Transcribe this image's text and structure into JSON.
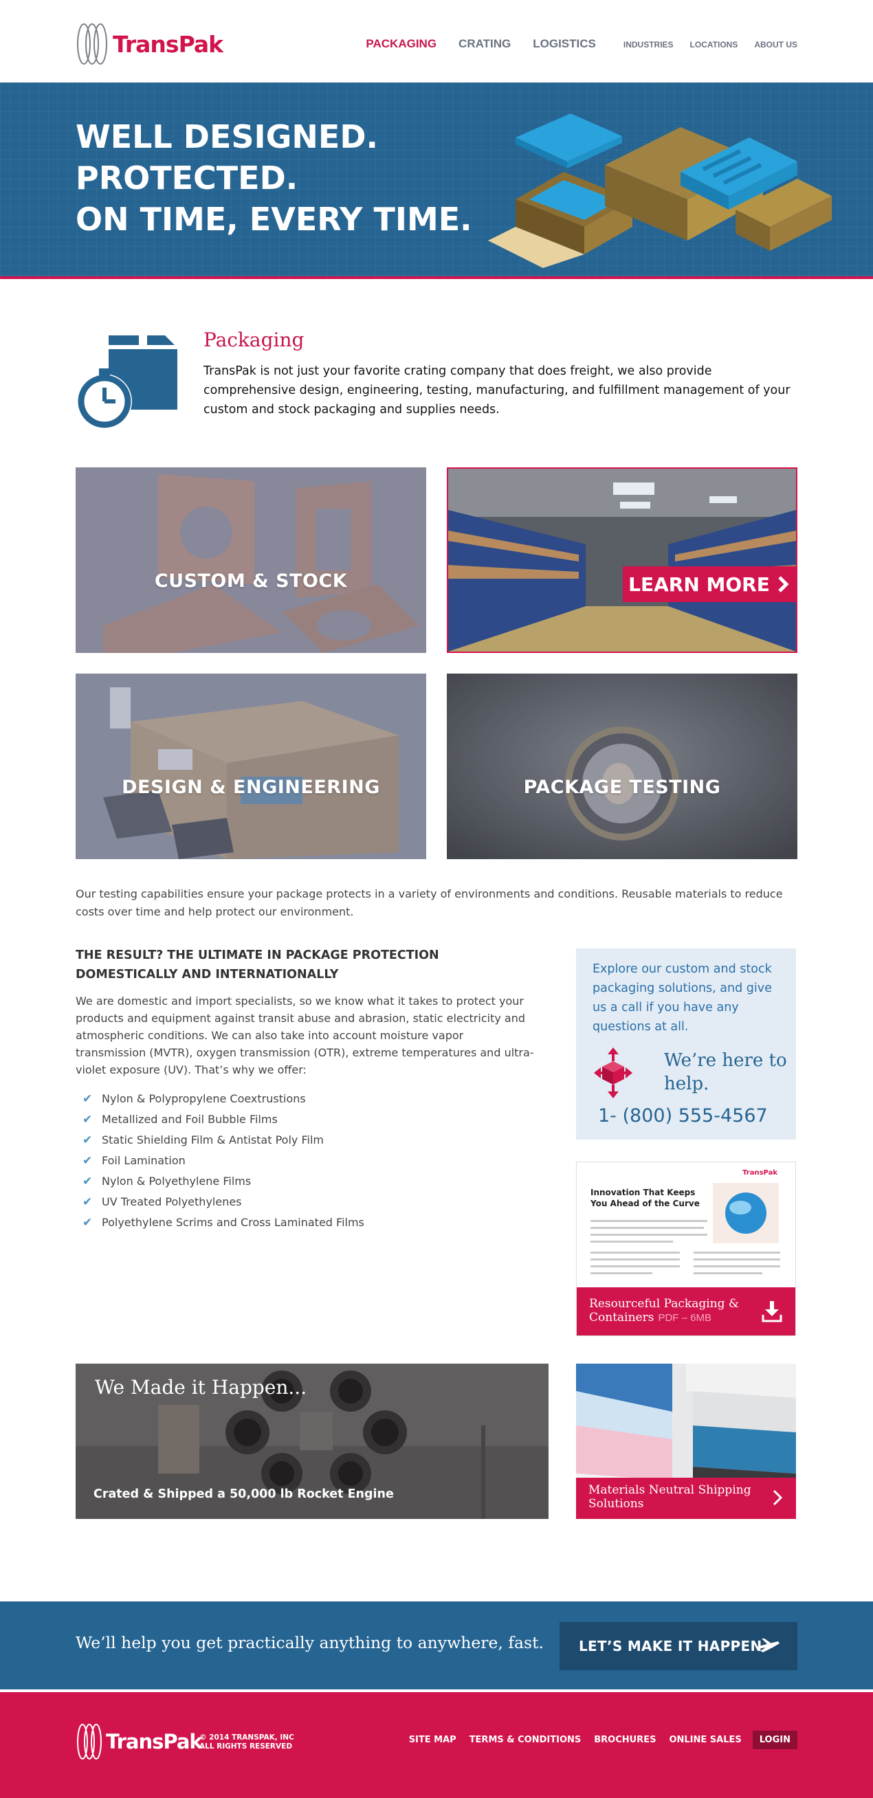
{
  "brand": {
    "name": "TransPak",
    "accent": "#d2144d",
    "blue": "#266492"
  },
  "nav": {
    "items": [
      {
        "label": "PACKAGING",
        "active": true
      },
      {
        "label": "CRATING",
        "active": false
      },
      {
        "label": "LOGISTICS",
        "active": false
      },
      {
        "label": "INDUSTRIES",
        "active": false
      },
      {
        "label": "LOCATIONS",
        "active": false
      },
      {
        "label": "ABOUT US",
        "active": false
      }
    ]
  },
  "hero": {
    "lines": [
      "WELL DESIGNED.",
      "PROTECTED.",
      "ON TIME, EVERY TIME."
    ]
  },
  "intro": {
    "icon": "box-stopwatch-icon",
    "title": "Packaging",
    "text": "TransPak is not just your favorite crating company that does freight, we also provide comprehensive design, engineering, testing, manufacturing, and fulfillment management of your custom and stock packaging and supplies needs."
  },
  "tiles": [
    {
      "label": "CUSTOM & STOCK"
    },
    {
      "label": "LEARN MORE",
      "button_icon": "chevron-right-icon"
    },
    {
      "label": "DESIGN & ENGINEERING"
    },
    {
      "label": "PACKAGE TESTING"
    }
  ],
  "testing_text": "Our testing capabilities ensure your package protects in a variety of environments and conditions. Reusable materials to reduce costs over time and help protect our environment.",
  "result": {
    "title": "THE RESULT? THE ULTIMATE IN PACKAGE PROTECTION DOMESTICALLY AND INTERNATIONALLY",
    "text": "We are domestic and import specialists, so we know what it takes to protect your products and equipment against transit abuse and abrasion, static electricity and atmospheric conditions. We can also take into account moisture vapor transmission (MVTR), oxygen transmission (OTR), extreme temperatures and ultra-violet exposure (UV). That’s why we offer:",
    "offers": [
      "Nylon & Polypropylene Coextrustions",
      "Metallized and Foil Bubble Films",
      "Static Shielding Film & Antistat Poly Film",
      "Foil Lamination",
      "Nylon & Polyethylene Films",
      "UV Treated Polyethylenes",
      "Polyethylene Scrims and Cross Laminated Films"
    ]
  },
  "help": {
    "text": "Explore our custom and stock packaging solutions, and give us a call if you have any questions at all.",
    "heading": "We’re here to help.",
    "phone": "1- (800) 555-4567"
  },
  "brochure": {
    "heading": "Innovation That Keeps You Ahead of the Curve",
    "small_logo": "TransPak",
    "title": "Resourceful Packaging & Containers",
    "size": "PDF – 6MB",
    "icon": "download-icon"
  },
  "rocket": {
    "title": "We Made it Happen...",
    "caption": "Crated & Shipped a 50,000 lb Rocket Engine"
  },
  "materials": {
    "title": "Materials Neutral Shipping Solutions",
    "icon": "chevron-right-icon"
  },
  "cta": {
    "text": "We’ll help you get practically anything to anywhere, fast.",
    "button": "LET’S MAKE IT HAPPEN",
    "icon": "airplane-icon"
  },
  "footer": {
    "logo": "TransPak",
    "copyright_line1": "© 2014 TRANSPAK, INC",
    "copyright_line2": "ALL RIGHTS RESERVED",
    "links": [
      "SITE MAP",
      "TERMS & CONDITIONS",
      "BROCHURES",
      "ONLINE SALES"
    ],
    "login": "LOGIN"
  }
}
